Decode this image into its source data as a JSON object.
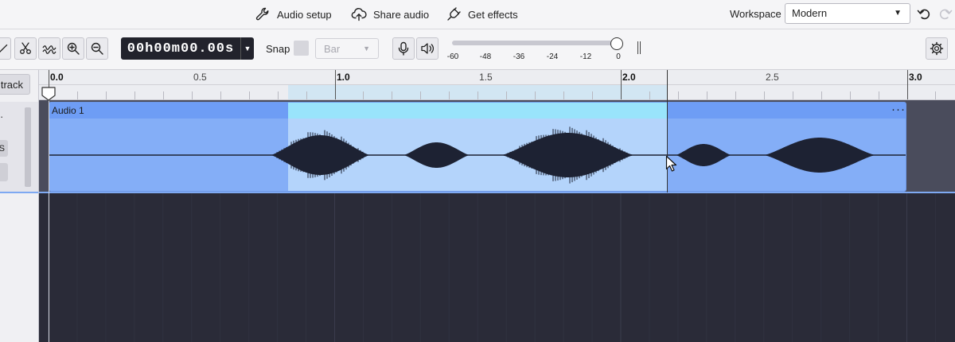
{
  "menu": {
    "audio_setup": "Audio setup",
    "share_audio": "Share audio",
    "get_effects": "Get effects",
    "workspace_label": "Workspace",
    "workspace_value": "Modern"
  },
  "toolbar": {
    "timecode": "00h00m00.00s",
    "snap_label": "Snap",
    "snap_value": "Bar",
    "meter_ticks": [
      "-60",
      "-48",
      "-36",
      "-24",
      "-12",
      "0"
    ],
    "playback_level": 1.0
  },
  "track_panel": {
    "add_track_label": "track",
    "track_dash": "·",
    "solo_label": "S"
  },
  "ruler": {
    "labels": [
      "0.0",
      "0.5",
      "1.0",
      "1.5",
      "2.0",
      "2.5",
      "3.0"
    ]
  },
  "clip": {
    "title": "Audio 1",
    "menu": "···"
  },
  "selection": {
    "start": 0.833,
    "end": 2.156
  },
  "colors": {
    "clip": "#84aef7",
    "clip_selected": "#b4d4fb",
    "clip_header_selected": "#99e4fb",
    "background": "#2a2b38"
  },
  "icons": {
    "audio_setup": "wrench-icon",
    "share_audio": "cloud-upload-icon",
    "get_effects": "plug-icon",
    "undo": "undo-icon",
    "redo": "redo-icon",
    "settings": "gear-icon"
  }
}
